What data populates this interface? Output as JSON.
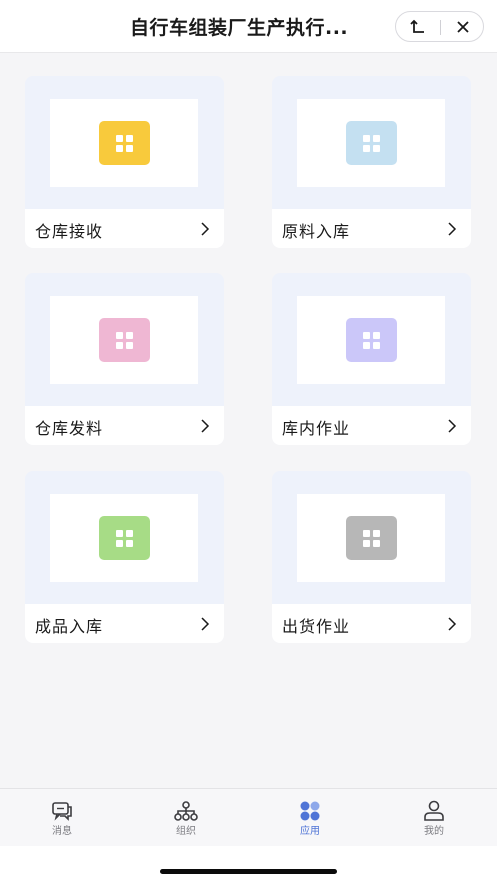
{
  "header": {
    "title": "自行车组装厂生产执行...",
    "back_icon": "return-arrow-icon",
    "close_icon": "close-icon"
  },
  "cards": [
    {
      "label": "仓库接收",
      "tile_color": "#f8ca3c",
      "icon": "grid-app-icon"
    },
    {
      "label": "原料入库",
      "tile_color": "#c4e0f1",
      "icon": "grid-app-icon"
    },
    {
      "label": "仓库发料",
      "tile_color": "#efb7d3",
      "icon": "grid-app-icon"
    },
    {
      "label": "库内作业",
      "tile_color": "#cbc7f9",
      "icon": "grid-app-icon"
    },
    {
      "label": "成品入库",
      "tile_color": "#a7dc86",
      "icon": "grid-app-icon"
    },
    {
      "label": "出货作业",
      "tile_color": "#b7b7b7",
      "icon": "grid-app-icon"
    }
  ],
  "tabbar": {
    "items": [
      {
        "label": "消息",
        "icon": "message-icon",
        "active": false
      },
      {
        "label": "组织",
        "icon": "organization-icon",
        "active": false
      },
      {
        "label": "应用",
        "icon": "apps-icon",
        "active": true
      },
      {
        "label": "我的",
        "icon": "profile-icon",
        "active": false
      }
    ],
    "active_color": "#4f74d6",
    "inactive_color": "#7b7b80"
  }
}
